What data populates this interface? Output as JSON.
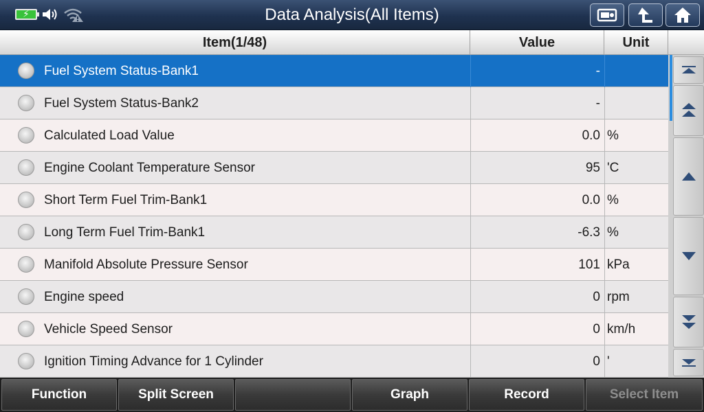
{
  "header": {
    "title": "Data Analysis(All Items)",
    "status_icons": [
      "battery-charging-icon",
      "speaker-icon",
      "wifi-warning-icon"
    ],
    "buttons": [
      {
        "name": "screenshot-button",
        "icon": "camera-screen-icon"
      },
      {
        "name": "back-button",
        "icon": "return-arrow-icon"
      },
      {
        "name": "home-button",
        "icon": "home-icon"
      }
    ]
  },
  "table": {
    "columns": {
      "item": "Item(1/48)",
      "value": "Value",
      "unit": "Unit"
    },
    "rows": [
      {
        "name": "Fuel System Status-Bank1",
        "value": "-",
        "unit": "",
        "selected": true
      },
      {
        "name": "Fuel System Status-Bank2",
        "value": "-",
        "unit": ""
      },
      {
        "name": "Calculated Load Value",
        "value": "0.0",
        "unit": "%"
      },
      {
        "name": "Engine Coolant Temperature Sensor",
        "value": "95",
        "unit": "'C"
      },
      {
        "name": "Short Term Fuel Trim-Bank1",
        "value": "0.0",
        "unit": "%"
      },
      {
        "name": "Long Term Fuel Trim-Bank1",
        "value": "-6.3",
        "unit": "%"
      },
      {
        "name": "Manifold Absolute Pressure Sensor",
        "value": "101",
        "unit": "kPa"
      },
      {
        "name": "Engine speed",
        "value": "0",
        "unit": "rpm"
      },
      {
        "name": "Vehicle Speed Sensor",
        "value": "0",
        "unit": "km/h"
      },
      {
        "name": "Ignition Timing Advance for 1 Cylinder",
        "value": "0",
        "unit": "'"
      }
    ]
  },
  "scroll_buttons": [
    "scroll-to-top-icon",
    "page-up-icon",
    "line-up-icon",
    "line-down-icon",
    "page-down-icon",
    "scroll-to-bottom-icon"
  ],
  "toolbar": {
    "function": "Function",
    "split_screen": "Split Screen",
    "empty": "",
    "graph": "Graph",
    "record": "Record",
    "select_item": "Select Item",
    "select_item_enabled": false
  },
  "colors": {
    "selected_row": "#1571c6",
    "title_bar": "#1f3250",
    "scroll_thumb": "#2b8de0"
  }
}
